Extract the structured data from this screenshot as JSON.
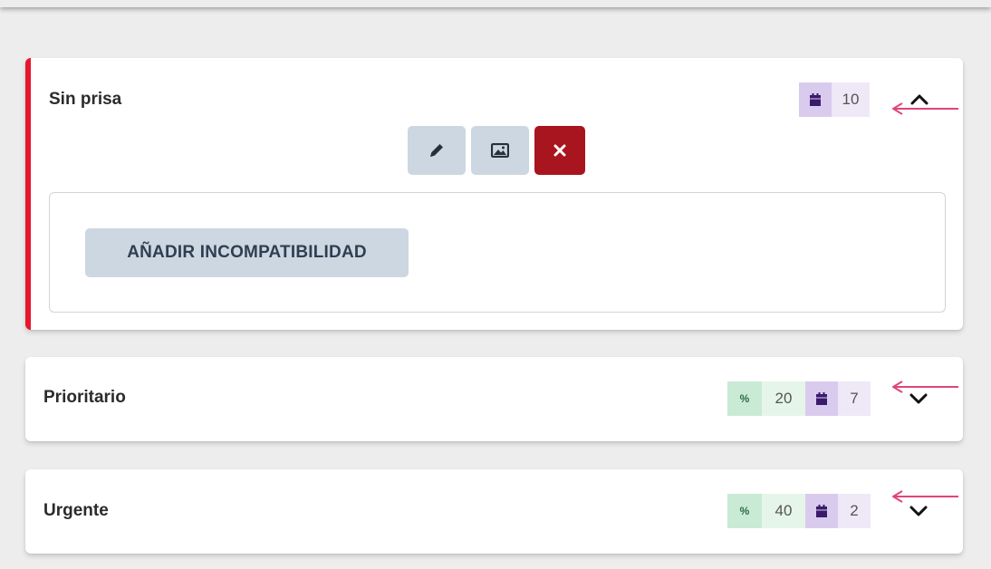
{
  "cards": [
    {
      "title": "Sin prisa",
      "calendar_value": "10",
      "expanded": true,
      "accent_color": "#e8152e",
      "actions": {
        "edit_icon": "pencil-icon",
        "image_icon": "image-icon",
        "delete_icon": "close-icon"
      },
      "add_button_label": "AÑADIR INCOMPATIBILIDAD"
    },
    {
      "title": "Prioritario",
      "percent_symbol": "%",
      "percent_value": "20",
      "calendar_value": "7",
      "expanded": false
    },
    {
      "title": "Urgente",
      "percent_symbol": "%",
      "percent_value": "40",
      "calendar_value": "2",
      "expanded": false
    }
  ],
  "colors": {
    "annotation_arrow": "#e0457b",
    "delete_button": "#a8151e",
    "neutral_button": "#cdd7e1",
    "calendar_badge": "#d9cbee",
    "percent_badge": "#c9ead5"
  }
}
